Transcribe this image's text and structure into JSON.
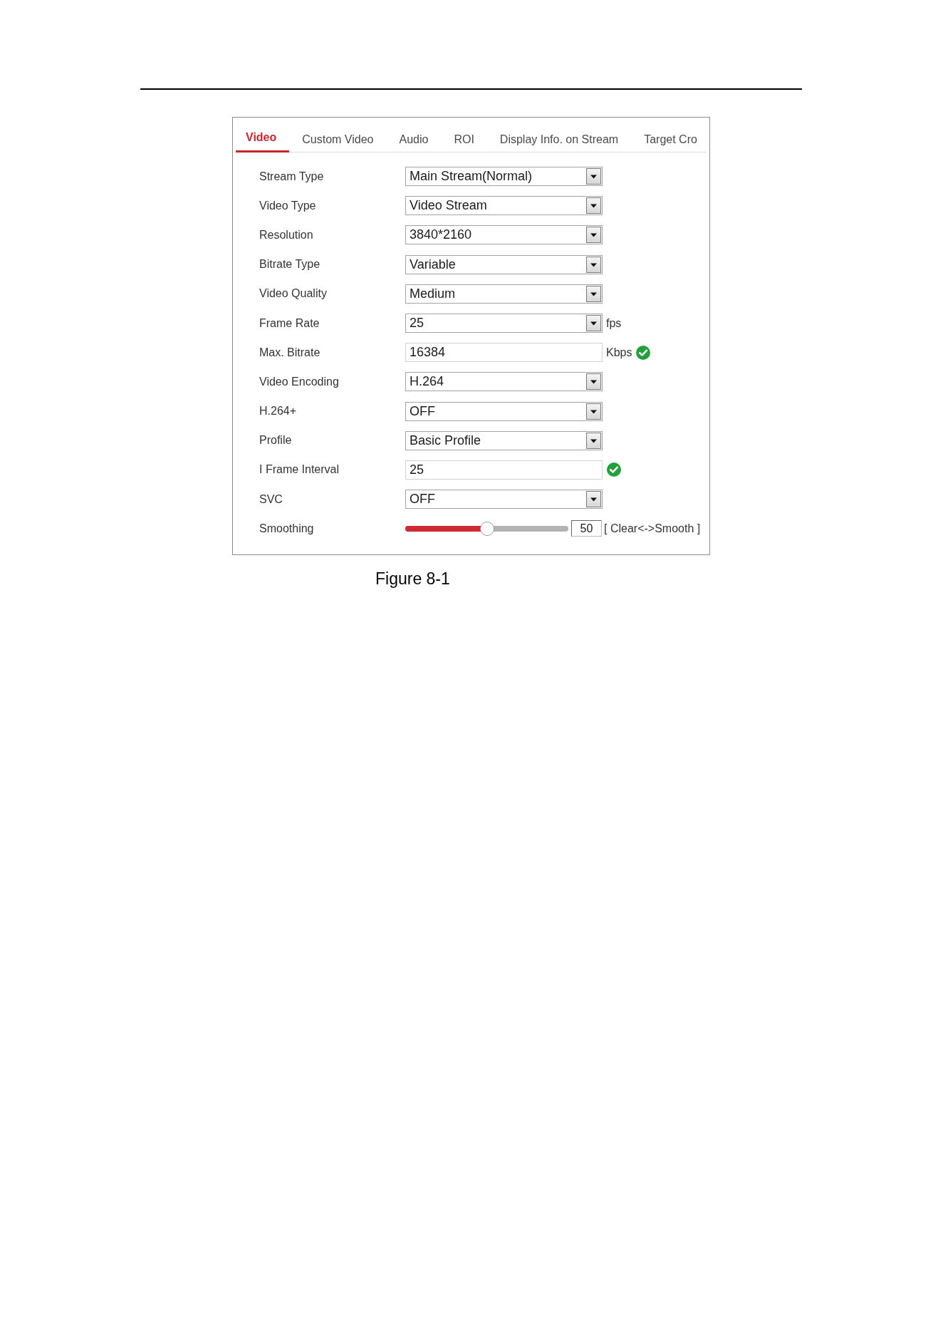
{
  "tabs": [
    {
      "label": "Video",
      "selected": true
    },
    {
      "label": "Custom Video",
      "selected": false
    },
    {
      "label": "Audio",
      "selected": false
    },
    {
      "label": "ROI",
      "selected": false
    },
    {
      "label": "Display Info. on Stream",
      "selected": false
    },
    {
      "label": "Target Cro",
      "selected": false
    }
  ],
  "fields": [
    {
      "kind": "select",
      "label": "Stream Type",
      "value": "Main Stream(Normal)"
    },
    {
      "kind": "select",
      "label": "Video Type",
      "value": "Video Stream"
    },
    {
      "kind": "select",
      "label": "Resolution",
      "value": "3840*2160"
    },
    {
      "kind": "select",
      "label": "Bitrate Type",
      "value": "Variable"
    },
    {
      "kind": "select",
      "label": "Video Quality",
      "value": "Medium"
    },
    {
      "kind": "select",
      "label": "Frame Rate",
      "value": "25",
      "unit": "fps"
    },
    {
      "kind": "input",
      "label": "Max. Bitrate",
      "value": "16384",
      "unit": "Kbps",
      "valid": true
    },
    {
      "kind": "select",
      "label": "Video Encoding",
      "value": "H.264"
    },
    {
      "kind": "select",
      "label": "H.264+",
      "value": "OFF"
    },
    {
      "kind": "select",
      "label": "Profile",
      "value": "Basic Profile"
    },
    {
      "kind": "input",
      "label": "I Frame Interval",
      "value": "25",
      "valid": true
    },
    {
      "kind": "select",
      "label": "SVC",
      "value": "OFF"
    },
    {
      "kind": "slider",
      "label": "Smoothing",
      "level": 0.5,
      "value": "50",
      "hint": "[ Clear<->Smooth ]"
    }
  ],
  "caption": "Figure 8-1"
}
